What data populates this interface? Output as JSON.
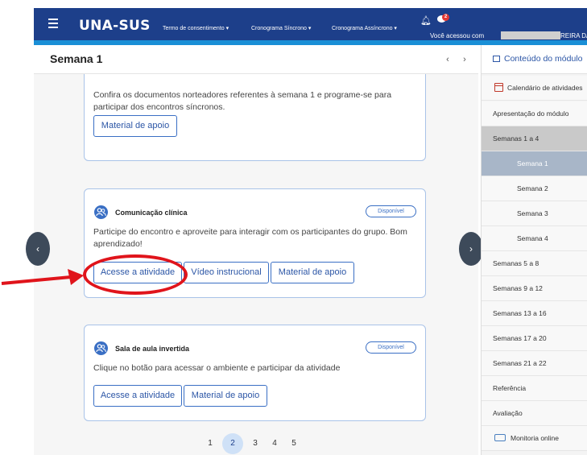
{
  "topbar": {
    "logo": "UNA-SUS",
    "nav": [
      "Termo de consentimento ▾",
      "Cronograma Síncrono ▾",
      "Cronograma Assíncrono ▾"
    ],
    "message_badge": "2",
    "access_text": "Você acessou com",
    "user_suffix": "REIRA DA"
  },
  "header": {
    "title": "Semana 1",
    "prev": "‹",
    "next": "›"
  },
  "cards": [
    {
      "description": "Confira os documentos norteadores referentes à semana 1 e programe-se para participar dos encontros síncronos.",
      "buttons": [
        "Material de apoio"
      ]
    },
    {
      "title": "Comunicação clínica",
      "badge": "Disponível",
      "description": "Participe do encontro e aproveite para interagir com os participantes do grupo. Bom aprendizado!",
      "buttons": [
        "Acesse a atividade",
        "Vídeo instrucional",
        "Material de apoio"
      ]
    },
    {
      "title": "Sala de aula invertida",
      "badge": "Disponível",
      "description": "Clique no botão para acessar o ambiente e participar da atividade",
      "buttons": [
        "Acesse a atividade",
        "Material de apoio"
      ]
    }
  ],
  "side_arrows": {
    "left": "‹",
    "right": "›"
  },
  "pagination": {
    "pages": [
      "1",
      "2",
      "3",
      "4",
      "5"
    ],
    "current": "2"
  },
  "sidebar": {
    "title": "Conteúdo do módulo",
    "items": [
      "Calendário de atividades",
      "Apresentação do módulo",
      "Semanas 1 a 4",
      "Semana 1",
      "Semana 2",
      "Semana 3",
      "Semana 4",
      "Semanas 5 a 8",
      "Semanas 9 a 12",
      "Semanas 13 a 16",
      "Semanas 17 a 20",
      "Semanas 21 a 22",
      "Referência",
      "Avaliação",
      "Monitoria online"
    ]
  },
  "colors": {
    "topbar": "#1d3f8a",
    "accent": "#1a8fd6",
    "annotation": "#e0141b",
    "button_border": "#3a6fc4"
  }
}
